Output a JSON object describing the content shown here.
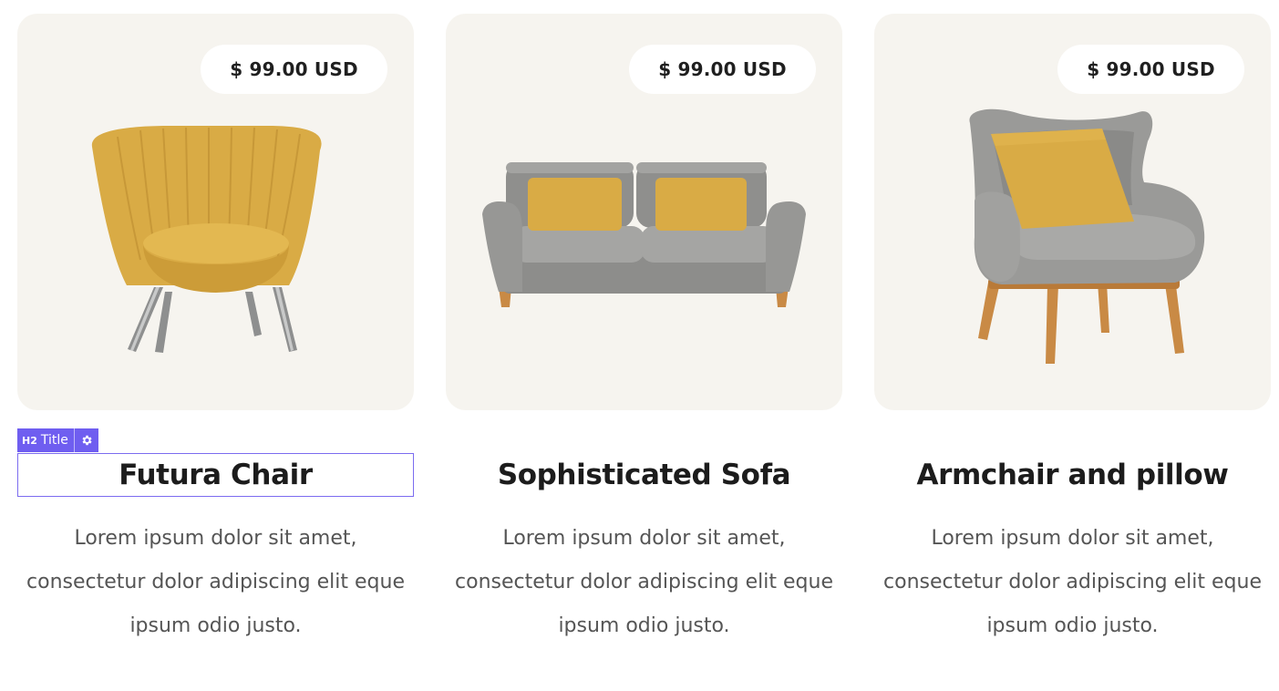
{
  "products": [
    {
      "price": "$ 99.00 USD",
      "title": "Futura Chair",
      "description": "Lorem ipsum dolor sit amet, consectetur dolor adipiscing elit eque ipsum odio justo.",
      "image": "mustard-tub-chair"
    },
    {
      "price": "$ 99.00 USD",
      "title": "Sophisticated Sofa",
      "description": "Lorem ipsum dolor sit amet, consectetur dolor adipiscing elit eque ipsum odio justo.",
      "image": "grey-sofa-with-pillows"
    },
    {
      "price": "$ 99.00 USD",
      "title": "Armchair and pillow",
      "description": "Lorem ipsum dolor sit amet, consectetur dolor adipiscing elit eque ipsum odio justo.",
      "image": "grey-wingback-armchair"
    }
  ],
  "editor": {
    "tag_heading": "H2",
    "tag_label": "Title",
    "settings_icon": "gear-icon"
  },
  "colors": {
    "card_background": "#f6f4ef",
    "mustard": "#d9ab45",
    "grey_fabric": "#9a9a98",
    "wood": "#c98a45",
    "selection_accent": "#6f5ef0"
  }
}
